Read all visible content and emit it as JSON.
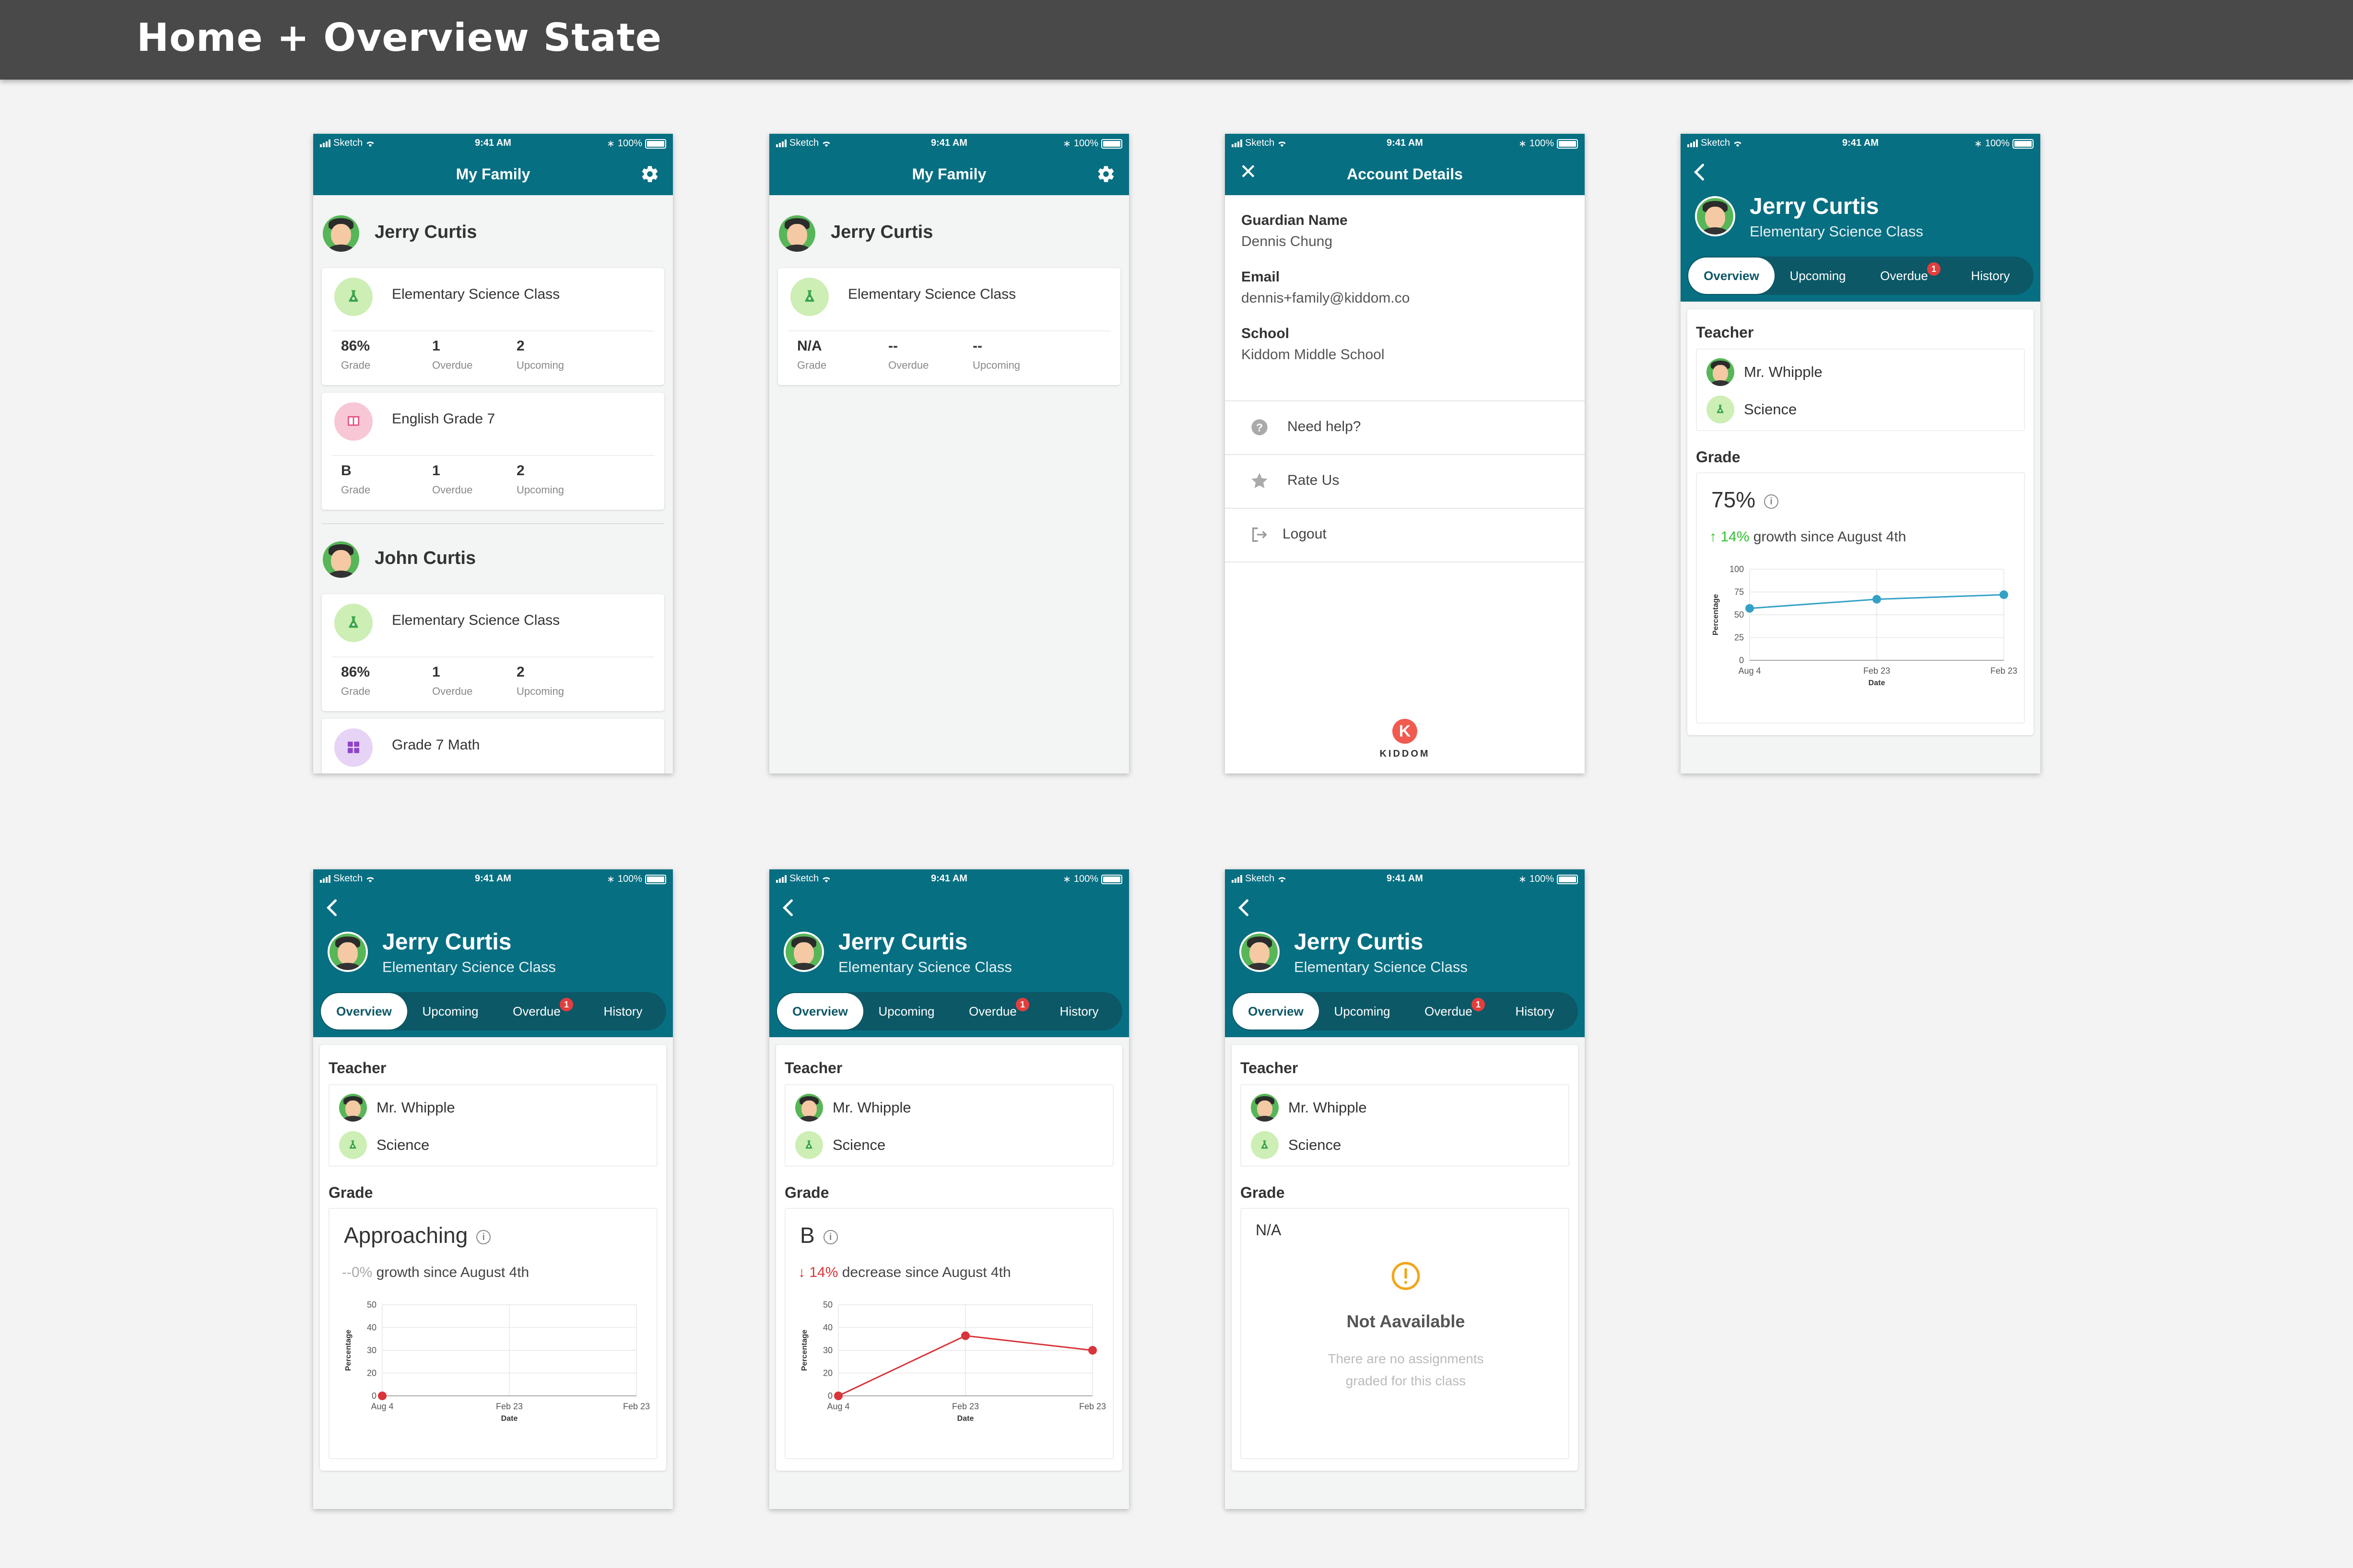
{
  "board_title": "Home + Overview State",
  "status": {
    "carrier": "Sketch",
    "time": "9:41 AM",
    "battery": "100%"
  },
  "home1": {
    "title": "My Family",
    "students": [
      {
        "name": "Jerry Curtis",
        "classes": [
          {
            "name": "Elementary Science Class",
            "grade": "86%",
            "overdue": "1",
            "upcoming": "2"
          },
          {
            "name": "English Grade 7",
            "grade": "B",
            "overdue": "1",
            "upcoming": "2"
          }
        ]
      },
      {
        "name": "John Curtis",
        "classes": [
          {
            "name": "Elementary Science Class",
            "grade": "86%",
            "overdue": "1",
            "upcoming": "2"
          },
          {
            "name": "Grade 7 Math"
          }
        ]
      }
    ],
    "labels": {
      "grade": "Grade",
      "overdue": "Overdue",
      "upcoming": "Upcoming"
    }
  },
  "home2": {
    "title": "My Family",
    "student": "Jerry Curtis",
    "class_name": "Elementary Science Class",
    "grade": "N/A",
    "overdue": "--",
    "upcoming": "--"
  },
  "account": {
    "title": "Account Details",
    "fields": [
      {
        "label": "Guardian Name",
        "value": "Dennis Chung"
      },
      {
        "label": "Email",
        "value": "dennis+family@kiddom.co"
      },
      {
        "label": "School",
        "value": "Kiddom Middle School"
      }
    ],
    "menu": [
      "Need help?",
      "Rate Us",
      "Logout"
    ],
    "logo_letter": "K",
    "logo_word": "KIDDOM"
  },
  "overview": {
    "student": "Jerry Curtis",
    "class_name": "Elementary Science Class",
    "tabs": [
      "Overview",
      "Upcoming",
      "Overdue",
      "History"
    ],
    "badge": "1",
    "teacher_label": "Teacher",
    "teacher": "Mr. Whipple",
    "subject": "Science",
    "grade_label": "Grade",
    "axis_title_y": "Percentage",
    "axis_title_x": "Date"
  },
  "ov1": {
    "grade": "75%",
    "growth_pct": "14%",
    "growth_text": " growth since August 4th",
    "color": "#2ec32e"
  },
  "ov2": {
    "grade": "Approaching",
    "growth_pct": "--0%",
    "growth_text": " growth since August 4th",
    "color": "#aaaaaa"
  },
  "ov3": {
    "grade": "B",
    "growth_pct": "14%",
    "growth_text": " decrease since August 4th",
    "color": "#d9343a"
  },
  "ov4": {
    "grade": "N/A",
    "na_title": "Not Aavailable",
    "na_desc": "There are no assignments graded for this class"
  },
  "chart_data": [
    {
      "type": "line",
      "x": [
        "Aug 4",
        "Feb 23",
        "Feb 23"
      ],
      "series": [
        {
          "values": [
            57,
            67,
            72
          ]
        }
      ],
      "yticks": [
        "100",
        "75",
        "50",
        "25",
        "0"
      ],
      "ylim": [
        0,
        100
      ],
      "xlabel": "Date",
      "ylabel": "Percentage",
      "color": "#33a1c6"
    },
    {
      "type": "line",
      "x": [
        "Aug 4",
        "Feb 23",
        "Feb 23"
      ],
      "series": [
        {
          "values": [
            0
          ]
        }
      ],
      "yticks": [
        "50",
        "40",
        "30",
        "20",
        "0"
      ],
      "ylim": [
        0,
        50
      ],
      "xlabel": "Date",
      "ylabel": "Percentage",
      "color": "#d9343a"
    },
    {
      "type": "line",
      "x": [
        "Aug 4",
        "Feb 23",
        "Feb 23"
      ],
      "series": [
        {
          "values": [
            0,
            33,
            25
          ]
        }
      ],
      "yticks": [
        "50",
        "40",
        "30",
        "20",
        "0"
      ],
      "ylim": [
        0,
        50
      ],
      "xlabel": "Date",
      "ylabel": "Percentage",
      "color": "#d9343a"
    }
  ]
}
